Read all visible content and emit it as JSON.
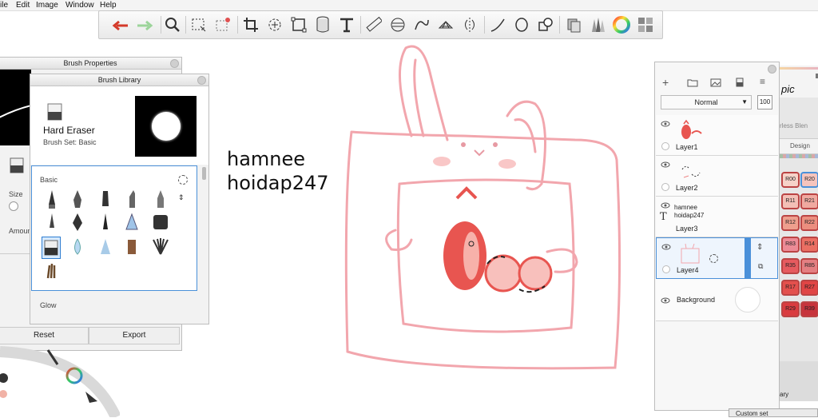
{
  "menu": [
    "ile",
    "Edit",
    "Image",
    "Window",
    "Help"
  ],
  "toolbar": {
    "tools": [
      "undo-icon",
      "redo-icon",
      "zoom-icon",
      "rect-select-icon",
      "magic-select-icon",
      "crop-icon",
      "transform-icon",
      "distort-icon",
      "bucket-icon",
      "text-icon",
      "ruler-icon",
      "ellipse-guide-icon",
      "curve-guide-icon",
      "perspective-icon",
      "symmetry-icon",
      "stroke-icon",
      "ellipse-icon",
      "shape-icon",
      "copic-icon",
      "brush-lib-icon",
      "color-wheel-icon",
      "layers-icon"
    ]
  },
  "brush_properties": {
    "title": "Brush Properties",
    "size_label": "Size",
    "amount_label": "Amoun",
    "reset": "Reset",
    "export": "Export"
  },
  "brush_library": {
    "title": "Brush Library",
    "brush_name": "Hard Eraser",
    "brush_set": "Brush Set: Basic",
    "section_basic": "Basic",
    "section_glow": "Glow"
  },
  "canvas_text": {
    "line1": "hamnee",
    "line2": "hoidap247"
  },
  "layers": {
    "blend_mode": "Normal",
    "opacity": "100",
    "items": [
      {
        "name": "Layer1"
      },
      {
        "name": "Layer2"
      },
      {
        "name": "Layer3",
        "text_preview_1": "hamnee",
        "text_preview_2": "hoidap247"
      },
      {
        "name": "Layer4"
      },
      {
        "name": "Background"
      }
    ]
  },
  "copic": {
    "title": "pic",
    "blend_label": "rless Blen",
    "tab_design": "Design",
    "swatches": [
      {
        "code": "R00",
        "color": "#f6d2c8"
      },
      {
        "code": "R20",
        "color": "#f5c4bd"
      },
      {
        "code": "R11",
        "color": "#f3bfb6"
      },
      {
        "code": "R21",
        "color": "#f0a9a0"
      },
      {
        "code": "R12",
        "color": "#ee9f8e"
      },
      {
        "code": "R22",
        "color": "#ec8e7f"
      },
      {
        "code": "R83",
        "color": "#ec8b96"
      },
      {
        "code": "R14",
        "color": "#ea6f63"
      },
      {
        "code": "R35",
        "color": "#e65b5f"
      },
      {
        "code": "R85",
        "color": "#e47f82"
      },
      {
        "code": "R17",
        "color": "#e3504d"
      },
      {
        "code": "R27",
        "color": "#e04545"
      },
      {
        "code": "R29",
        "color": "#d93b3f"
      },
      {
        "code": "R39",
        "color": "#c7343c"
      }
    ],
    "bottom_label": "ary",
    "custom_set": "Custom set"
  },
  "colors": {
    "accent_blue": "#4a90d9",
    "sketch_pink": "#f2a6ad",
    "lettering_red": "#e85550"
  }
}
